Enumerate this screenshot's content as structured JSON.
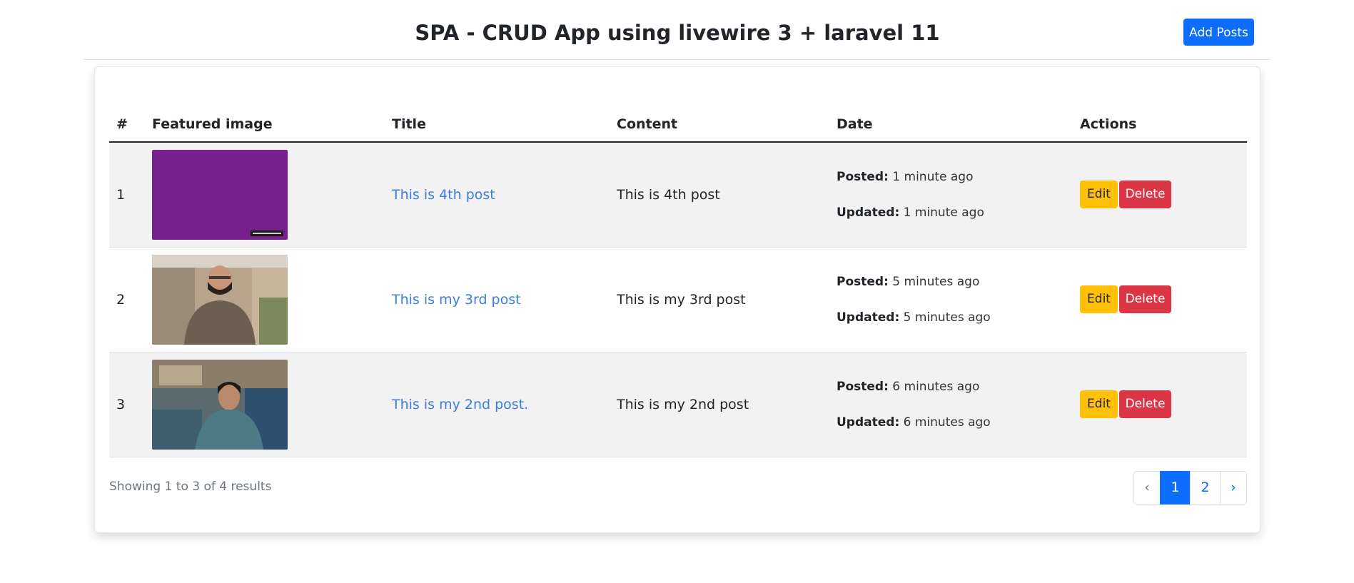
{
  "header": {
    "title": "SPA - CRUD App using livewire 3 + laravel 11",
    "add_button_label": "Add Posts"
  },
  "table": {
    "columns": [
      "#",
      "Featured image",
      "Title",
      "Content",
      "Date",
      "Actions"
    ],
    "rows": [
      {
        "index": "1",
        "title": "This is 4th post",
        "content": "This is 4th post",
        "posted_label": "Posted:",
        "posted_value": "1 minute ago",
        "updated_label": "Updated:",
        "updated_value": "1 minute ago",
        "edit_label": "Edit",
        "delete_label": "Delete",
        "image": "purple-placeholder-image"
      },
      {
        "index": "2",
        "title": "This is my 3rd post",
        "content": "This is my 3rd post",
        "posted_label": "Posted:",
        "posted_value": "5 minutes ago",
        "updated_label": "Updated:",
        "updated_value": "5 minutes ago",
        "edit_label": "Edit",
        "delete_label": "Delete",
        "image": "person-photo-outdoor"
      },
      {
        "index": "3",
        "title": "This is my 2nd post.",
        "content": "This is my 2nd post",
        "posted_label": "Posted:",
        "posted_value": "6 minutes ago",
        "updated_label": "Updated:",
        "updated_value": "6 minutes ago",
        "edit_label": "Edit",
        "delete_label": "Delete",
        "image": "person-photo-indoor"
      }
    ]
  },
  "footer": {
    "summary": "Showing 1 to 3 of 4 results",
    "pagination": {
      "prev": "‹",
      "pages": [
        "1",
        "2"
      ],
      "active_page": "1",
      "next": "›"
    }
  },
  "colors": {
    "primary": "#0d6efd",
    "warning": "#ffc107",
    "danger": "#dc3545",
    "link": "#3b7ddd",
    "stripe": "#f2f2f2"
  }
}
